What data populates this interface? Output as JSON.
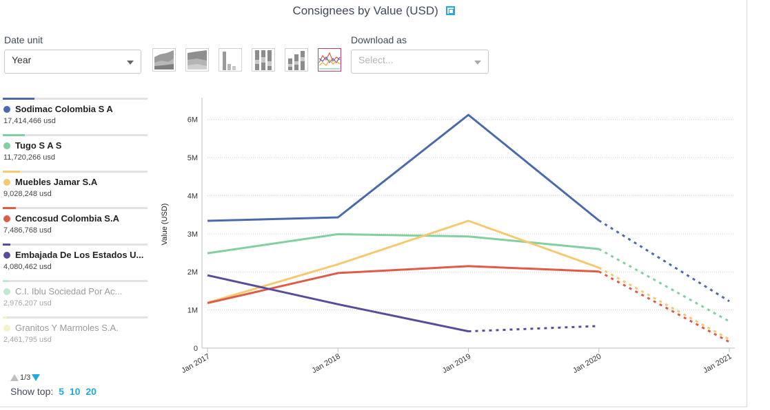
{
  "title": "Consignees by Value (USD)",
  "controls": {
    "date_unit_label": "Date unit",
    "date_unit_value": "Year",
    "download_label": "Download as",
    "download_placeholder": "Select..."
  },
  "chart_types": [
    {
      "icon": "stacked-area-icon",
      "active": false
    },
    {
      "icon": "percent-area-icon",
      "active": false
    },
    {
      "icon": "bar-chart-icon",
      "active": false
    },
    {
      "icon": "percent-bar-icon",
      "active": false
    },
    {
      "icon": "stacked-bar-icon",
      "active": false
    },
    {
      "icon": "line-chart-icon",
      "active": true
    }
  ],
  "legend": [
    {
      "name": "Sodimac Colombia S A",
      "value": "17,414,466 usd",
      "share": 0.22,
      "color": "#4a6aab",
      "faded": false
    },
    {
      "name": "Tugo S A S",
      "value": "11,720,266 usd",
      "share": 0.15,
      "color": "#82cfa0",
      "faded": false
    },
    {
      "name": "Muebles Jamar S.A",
      "value": "9,028,248 usd",
      "share": 0.12,
      "color": "#f7c96e",
      "faded": false
    },
    {
      "name": "Cencosud Colombia S.A",
      "value": "7,486,768 usd",
      "share": 0.09,
      "color": "#e05a48",
      "faded": false
    },
    {
      "name": "Embajada De Los Estados U...",
      "value": "4,080,462 usd",
      "share": 0.05,
      "color": "#5a4b9b",
      "faded": false
    },
    {
      "name": "C.I. Iblu Sociedad Por Ac...",
      "value": "2,976,207 usd",
      "share": 0.04,
      "color": "#bfe8d5",
      "faded": true
    },
    {
      "name": "Granitos Y Marmoles S.A.",
      "value": "2,461,795 usd",
      "share": 0.03,
      "color": "#f4f3c8",
      "faded": true
    }
  ],
  "pager": {
    "label": "1/3"
  },
  "show_top": {
    "label": "Show top:",
    "options": [
      "5",
      "10",
      "20"
    ]
  },
  "chart_data": {
    "type": "line",
    "title": "Consignees by Value (USD)",
    "xlabel": "",
    "ylabel": "Value (USD)",
    "categories": [
      "Jan 2017",
      "Jan 2018",
      "Jan 2019",
      "Jan 2020",
      "Jan 2021"
    ],
    "ylim": [
      0,
      6500000
    ],
    "yticks": [
      0,
      1000000,
      2000000,
      3000000,
      4000000,
      5000000,
      6000000
    ],
    "ytick_labels": [
      "0",
      "1M",
      "2M",
      "3M",
      "4M",
      "5M",
      "6M"
    ],
    "grid": true,
    "series": [
      {
        "name": "Sodimac Colombia S A",
        "color": "#4a6aab",
        "values": [
          3340000,
          3430000,
          6120000,
          3350000,
          1230000
        ],
        "dashed_from": 3
      },
      {
        "name": "Tugo S A S",
        "color": "#82cfa0",
        "values": [
          2490000,
          2990000,
          2930000,
          2600000,
          700000
        ],
        "dashed_from": 3
      },
      {
        "name": "Muebles Jamar S.A",
        "color": "#f7c96e",
        "values": [
          1190000,
          2200000,
          3340000,
          2110000,
          230000
        ],
        "dashed_from": 3
      },
      {
        "name": "Cencosud Colombia S.A",
        "color": "#e05a48",
        "values": [
          1180000,
          1970000,
          2150000,
          2010000,
          160000
        ],
        "dashed_from": 3
      },
      {
        "name": "Embajada De Los Estados U...",
        "color": "#5a4b9b",
        "values": [
          1910000,
          1150000,
          440000,
          580000,
          null
        ],
        "dashed_from": 2
      }
    ]
  }
}
